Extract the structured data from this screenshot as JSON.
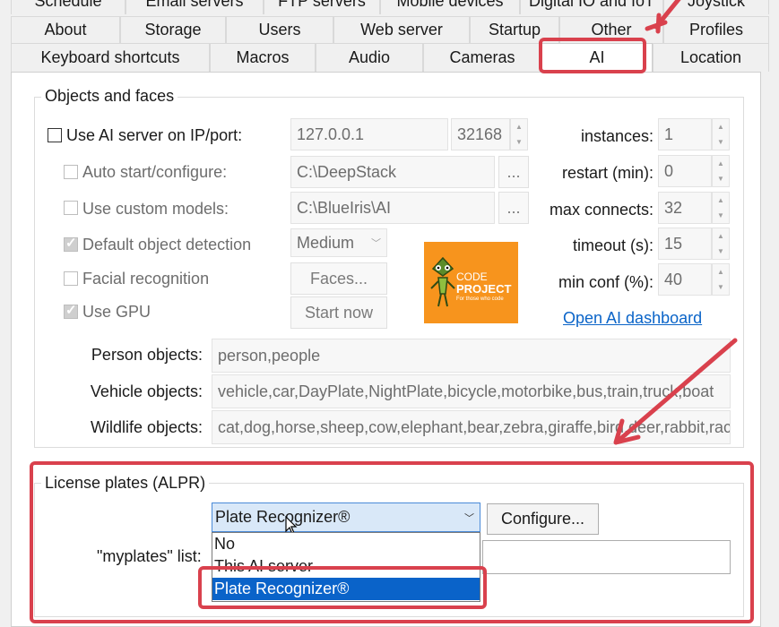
{
  "tabs": {
    "row1": [
      "Schedule",
      "Email servers",
      "FTP servers",
      "Mobile devices",
      "Digital IO and IoT",
      "Joystick"
    ],
    "row2": [
      "About",
      "Storage",
      "Users",
      "Web server",
      "Startup",
      "Other",
      "Profiles"
    ],
    "row3": [
      "Keyboard shortcuts",
      "Macros",
      "Audio",
      "Cameras",
      "AI",
      "Location"
    ]
  },
  "objects_group": {
    "legend": "Objects and faces",
    "use_ai_server": {
      "label": "Use AI server on IP/port:",
      "checked": false,
      "ip": "127.0.0.1",
      "port": "32168"
    },
    "auto_start": {
      "label": "Auto start/configure:",
      "checked": false,
      "path": "C:\\DeepStack",
      "browse": "..."
    },
    "custom_models": {
      "label": "Use custom models:",
      "checked": false,
      "path": "C:\\BlueIris\\AI",
      "browse": "..."
    },
    "default_detection": {
      "label": "Default object detection",
      "checked": true,
      "value": "Medium"
    },
    "facial_recognition": {
      "label": "Facial recognition",
      "checked": false,
      "button": "Faces..."
    },
    "use_gpu": {
      "label": "Use GPU",
      "checked": true,
      "button": "Start now"
    },
    "logo": {
      "line1": "CODE",
      "line2": "PROJECT",
      "tagline": "For those who code"
    },
    "right_fields": [
      {
        "label": "instances:",
        "value": "1"
      },
      {
        "label": "restart (min):",
        "value": "0"
      },
      {
        "label": "max connects:",
        "value": "32"
      },
      {
        "label": "timeout (s):",
        "value": "15"
      },
      {
        "label": "min conf (%):",
        "value": "40"
      }
    ],
    "dashboard_link": "Open AI dashboard",
    "person_objects": {
      "label": "Person objects:",
      "value": "person,people"
    },
    "vehicle_objects": {
      "label": "Vehicle objects:",
      "value": "vehicle,car,DayPlate,NightPlate,bicycle,motorbike,bus,train,truck,boat"
    },
    "wildlife_objects": {
      "label": "Wildlife objects:",
      "value": "cat,dog,horse,sheep,cow,elephant,bear,zebra,giraffe,bird,deer,rabbit,racc"
    }
  },
  "alpr_group": {
    "legend": "License plates (ALPR)",
    "combo_value": "Plate Recognizer®",
    "configure_button": "Configure...",
    "myplates_label": "\"myplates\" list:",
    "dropdown_options": [
      "No",
      "This AI server",
      "Plate Recognizer®"
    ],
    "selected_option": "Plate Recognizer®"
  },
  "colors": {
    "highlight": "#d9414d",
    "selection": "#0a63c9",
    "link": "#0a64c8",
    "logo_bg": "#f7941d"
  }
}
